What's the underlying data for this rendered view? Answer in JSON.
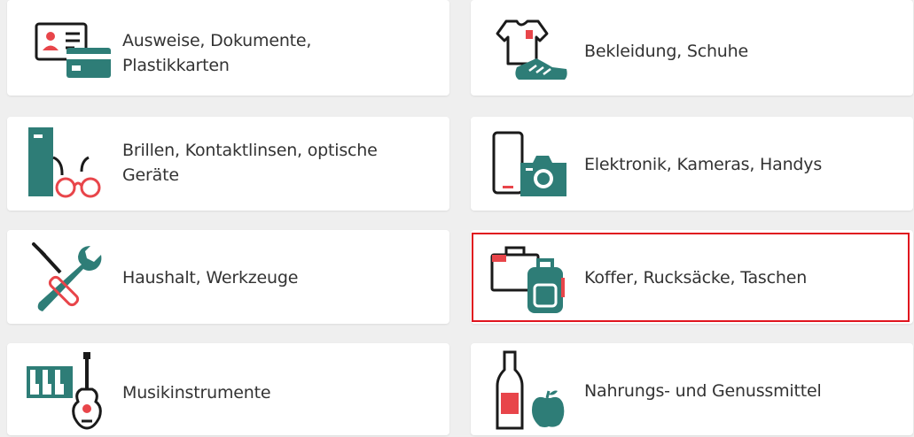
{
  "categories": [
    {
      "label": "Ausweise, Dokumente, Plastikkarten",
      "icon": "id-card-icon"
    },
    {
      "label": "Bekleidung, Schuhe",
      "icon": "clothing-shoe-icon"
    },
    {
      "label": "Brillen, Kontaktlinsen, optische Geräte",
      "icon": "glasses-icon"
    },
    {
      "label": "Elektronik, Kameras, Handys",
      "icon": "phone-camera-icon"
    },
    {
      "label": "Haushalt, Werkzeuge",
      "icon": "tools-icon"
    },
    {
      "label": "Koffer, Rucksäcke, Taschen",
      "icon": "suitcase-backpack-icon"
    },
    {
      "label": "Musikinstrumente",
      "icon": "music-instruments-icon"
    },
    {
      "label": "Nahrungs- und Genussmittel",
      "icon": "food-drink-icon"
    }
  ],
  "selected": "Koffer, Rucksäcke, Taschen",
  "colors": {
    "teal": "#2e7d77",
    "red": "#e8454a",
    "dark": "#1a1a1a",
    "highlight": "#e0141e"
  }
}
